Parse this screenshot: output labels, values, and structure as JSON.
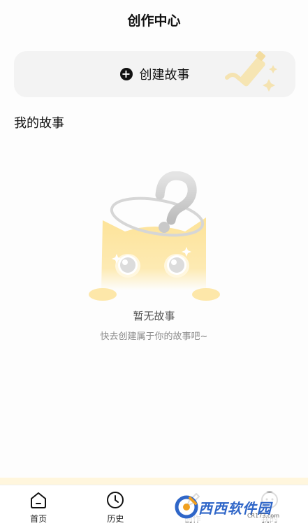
{
  "header": {
    "title": "创作中心"
  },
  "create": {
    "label": "创建故事",
    "plus_glyph": "+"
  },
  "section": {
    "title": "我的故事"
  },
  "empty": {
    "title": "暂无故事",
    "subtitle": "快去创建属于你的故事吧~"
  },
  "tabs": [
    {
      "label": "首页",
      "icon": "home-icon"
    },
    {
      "label": "历史",
      "icon": "clock-icon"
    },
    {
      "label": "创作",
      "icon": "create-icon"
    },
    {
      "label": "我的",
      "icon": "profile-icon"
    }
  ],
  "watermark": {
    "text": "西西软件园",
    "url": "CR173.com"
  },
  "colors": {
    "accent_yellow": "#fde9a6",
    "card_bg": "#f3f3f3",
    "text": "#111111"
  }
}
